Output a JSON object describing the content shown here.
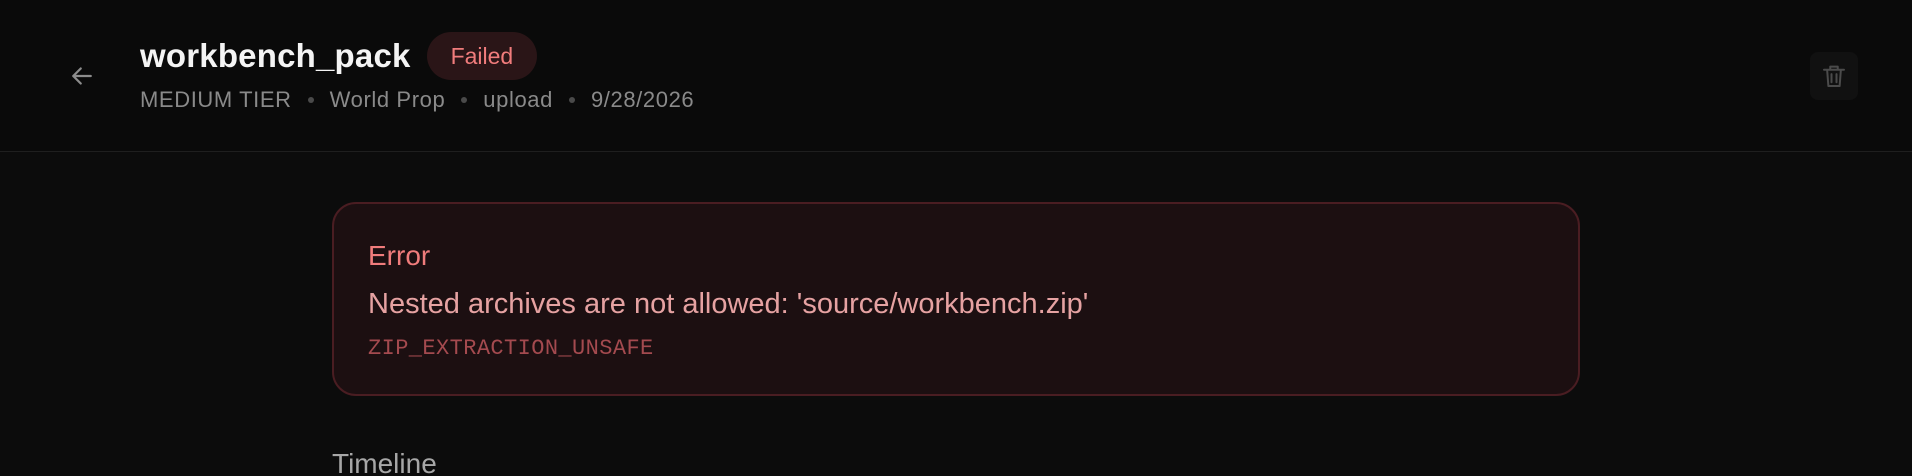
{
  "header": {
    "title": "workbench_pack",
    "status": "Failed",
    "meta": {
      "tier": "MEDIUM TIER",
      "category": "World Prop",
      "source": "upload",
      "date": "9/28/2026"
    },
    "icons": {
      "back": "arrow-left-icon",
      "delete": "trash-icon"
    }
  },
  "error": {
    "title": "Error",
    "message": "Nested archives are not allowed: 'source/workbench.zip'",
    "code": "ZIP_EXTRACTION_UNSAFE"
  },
  "sections": {
    "timeline_title": "Timeline"
  },
  "colors": {
    "background": "#0c0c0c",
    "status_failed_text": "#f07c7c",
    "status_failed_bg": "#2a1517",
    "error_border": "#4a1d22",
    "error_bg": "#1c0f11"
  }
}
